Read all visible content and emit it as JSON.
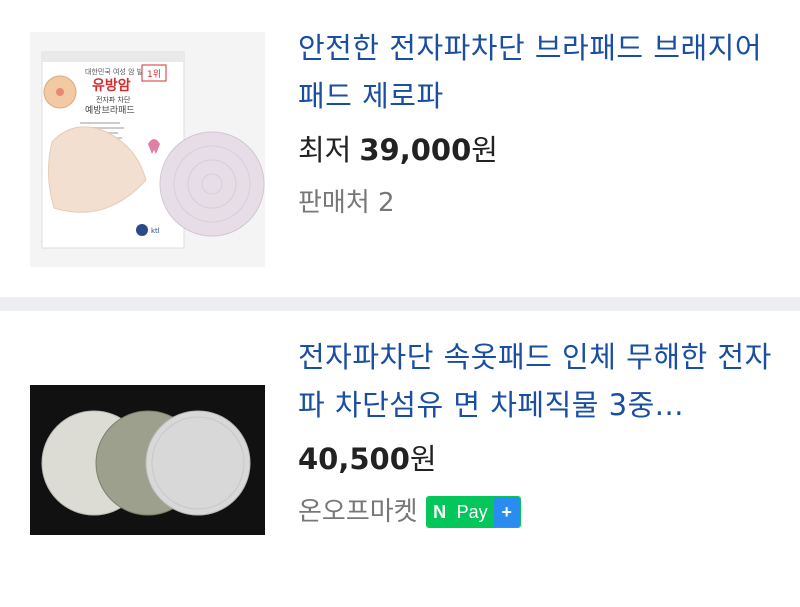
{
  "products": [
    {
      "title": "안전한 전자파차단 브라패드 브래지어 패드 제로파",
      "price_prefix": "최저",
      "price": "39,000",
      "price_unit": "원",
      "seller": "판매처 2",
      "image_text": {
        "top_small": "대한민국 여성 암 발병률",
        "badge": "1위",
        "headline": "유방암",
        "sub1": "전자파 차단",
        "sub2": "예방브라패드",
        "logo": "ktl"
      }
    },
    {
      "title": "전자파차단 속옷패드 인체 무해한 전자파 차단섬유 면 차페직물 3중...",
      "price": "40,500",
      "price_unit": "원",
      "seller": "온오프마켓",
      "badge": {
        "n": "N",
        "pay": "Pay",
        "plus": "+"
      }
    }
  ]
}
